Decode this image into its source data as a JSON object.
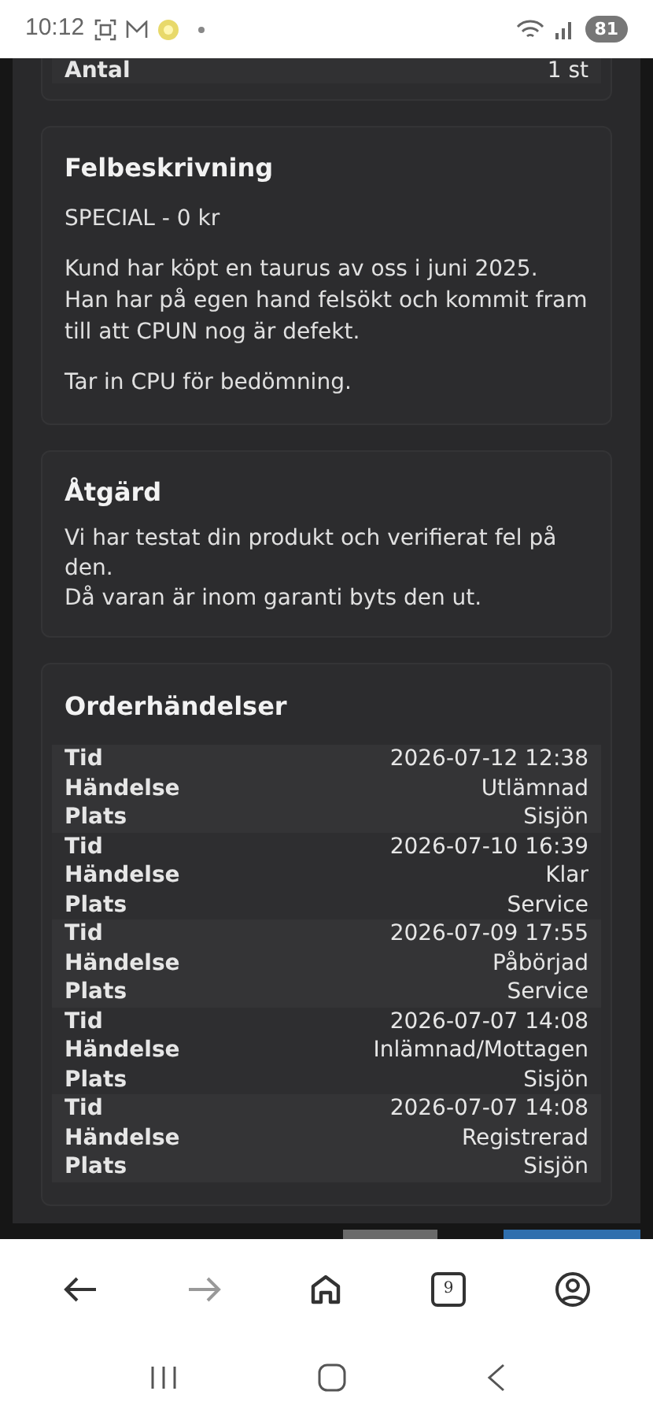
{
  "status_bar": {
    "time": "10:12",
    "battery": "81"
  },
  "details_card": {
    "rows": [
      {
        "label": "Antal",
        "value": "1 st"
      }
    ]
  },
  "fault_card": {
    "title": "Felbeskrivning",
    "paragraphs": [
      "SPECIAL - 0 kr",
      "Kund har köpt en taurus av oss i juni 2025. Han har på egen hand felsökt och kommit fram till att CPUN nog är defekt.",
      "Tar in CPU för bedömning."
    ]
  },
  "action_card": {
    "title": "Åtgärd",
    "lines": [
      "Vi har testat din produkt och verifierat fel på den.",
      "Då varan är inom garanti byts den ut."
    ]
  },
  "events_card": {
    "title": "Orderhändelser",
    "events": [
      {
        "fields": [
          {
            "label": "Tid",
            "value": "2026-07-12 12:38"
          },
          {
            "label": "Händelse",
            "value": "Utlämnad"
          },
          {
            "label": "Plats",
            "value": "Sisjön"
          }
        ]
      },
      {
        "fields": [
          {
            "label": "Tid",
            "value": "2026-07-10 16:39"
          },
          {
            "label": "Händelse",
            "value": "Klar"
          },
          {
            "label": "Plats",
            "value": "Service"
          }
        ]
      },
      {
        "fields": [
          {
            "label": "Tid",
            "value": "2026-07-09 17:55"
          },
          {
            "label": "Händelse",
            "value": "Påbörjad"
          },
          {
            "label": "Plats",
            "value": "Service"
          }
        ]
      },
      {
        "fields": [
          {
            "label": "Tid",
            "value": "2026-07-07 14:08"
          },
          {
            "label": "Händelse",
            "value": "Inlämnad/Mottagen"
          },
          {
            "label": "Plats",
            "value": "Sisjön"
          }
        ]
      },
      {
        "fields": [
          {
            "label": "Tid",
            "value": "2026-07-07 14:08"
          },
          {
            "label": "Händelse",
            "value": "Registrerad"
          },
          {
            "label": "Plats",
            "value": "Sisjön"
          }
        ]
      }
    ]
  },
  "browser_toolbar": {
    "tab_count": "9"
  }
}
